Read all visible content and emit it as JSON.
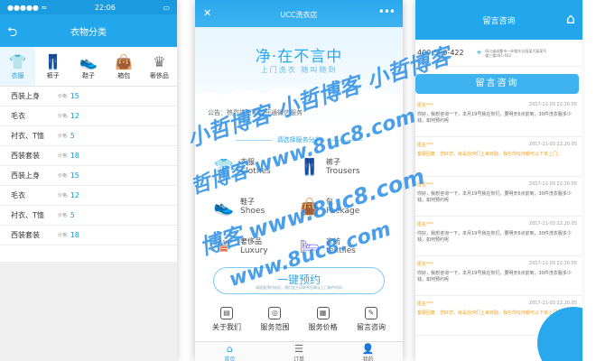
{
  "left": {
    "status": {
      "carrier": "●●●●● ≈",
      "time": "22:06",
      "battery": "▭"
    },
    "title": "衣物分类",
    "categories": [
      {
        "label": "衣服",
        "icon": "tshirt-icon",
        "glyph": "👕",
        "active": true
      },
      {
        "label": "裤子",
        "icon": "trousers-icon",
        "glyph": "👖",
        "active": false
      },
      {
        "label": "鞋子",
        "icon": "shoe-icon",
        "glyph": "👟",
        "active": false
      },
      {
        "label": "箱包",
        "icon": "bag-icon",
        "glyph": "👜",
        "active": false
      },
      {
        "label": "奢侈品",
        "icon": "crown-icon",
        "glyph": "♛",
        "active": false
      }
    ],
    "price_label": "价格:",
    "items": [
      {
        "name": "西装上身",
        "price": "15"
      },
      {
        "name": "毛衣",
        "price": "12"
      },
      {
        "name": "衬衣、T恤",
        "price": "5"
      },
      {
        "name": "西装套装",
        "price": "18"
      },
      {
        "name": "西装上身",
        "price": "15"
      },
      {
        "name": "毛衣",
        "price": "12"
      },
      {
        "name": "衬衣、T恤",
        "price": "5"
      },
      {
        "name": "西装套装",
        "price": "18"
      }
    ]
  },
  "center": {
    "title": "UCC洗衣店",
    "close_glyph": "✕",
    "more_glyph": "•••",
    "slogan": "净·在不言中",
    "slogan_sub": "上门洗衣  随叫随到",
    "notice": "公告：热烈祝贺本店开通微信服务",
    "section_title": "请选择服务分类",
    "services": [
      {
        "cn": "衣服",
        "en": "Clothes",
        "icon": "tshirt-icon",
        "glyph": "👕",
        "color": "#e84a8a"
      },
      {
        "cn": "裤子",
        "en": "Trousers",
        "icon": "trousers-icon",
        "glyph": "👖",
        "color": "#27b07a"
      },
      {
        "cn": "鞋子",
        "en": "Shoes",
        "icon": "shoe-icon",
        "glyph": "👟",
        "color": "#2ab7c8"
      },
      {
        "cn": "包",
        "en": "Package",
        "icon": "bag-icon",
        "glyph": "👜",
        "color": "#f2a21b"
      },
      {
        "cn": "奢侈品",
        "en": "Luxury",
        "icon": "crown-icon",
        "glyph": "♛",
        "color": "#e8663a"
      },
      {
        "cn": "家纺",
        "en": "textiles",
        "icon": "bed-icon",
        "glyph": "🛏",
        "color": "#7b6fe0"
      }
    ],
    "book_label": "一键预约",
    "book_note": "请留意预约电话，我们会主动联系您确认上门取件时间",
    "quick": [
      {
        "label": "关于我们",
        "icon": "about-icon",
        "glyph": "▤"
      },
      {
        "label": "服务范围",
        "icon": "scope-icon",
        "glyph": "◎"
      },
      {
        "label": "服务价格",
        "icon": "price-icon",
        "glyph": "▦"
      },
      {
        "label": "留言咨询",
        "icon": "message-icon",
        "glyph": "✎"
      }
    ],
    "tabs": [
      {
        "label": "首页",
        "icon": "home-icon",
        "glyph": "⌂",
        "active": true
      },
      {
        "label": "订单",
        "icon": "order-icon",
        "glyph": "☰",
        "active": false
      },
      {
        "label": "我的",
        "icon": "user-icon",
        "glyph": "👤",
        "active": false
      }
    ]
  },
  "right": {
    "title": "留言咨询",
    "home_glyph": "⌂",
    "phone": "400-500-422",
    "address": "四川省成都市一环路东五段某大厦某号楼三楼401-403",
    "msg_button": "留言咨询",
    "messages": [
      {
        "user": "匿名***",
        "time": "2017-11-03 22:20:05",
        "body": "你好，我想咨询一下，本月19号我在你们，要明天6点前到，30件洗衣服多少钱，如何预约呢",
        "reply": false
      },
      {
        "user": "匿名***",
        "time": "2017-11-03 22:20:05",
        "body": "客服回复：您好您，就是在你们上来收取，我在你在你都可以下单上门。",
        "reply": true
      },
      {
        "user": "匿名***",
        "time": "2017-11-03 22:20:05",
        "body": "你好，我想咨询一下，本月19号我在你们，要明天6点前到，30件洗衣服多少钱，如何预约呢",
        "reply": false
      },
      {
        "user": "匿名***",
        "time": "2017-11-03 22:20:05",
        "body": "你好，我想咨询一下，本月19号我在你们，要明天6点前到，30件洗衣服多少钱，如何预约呢",
        "reply": false
      },
      {
        "user": "匿名***",
        "time": "2017-11-03 22:20:05",
        "body": "你好，我想咨询一下，本月19号我在你们，要明天6点前到，30件洗衣服多少钱，如何预约呢",
        "reply": false
      },
      {
        "user": "匿名***",
        "time": "2017-11-03 22:20:05",
        "body": "客服回复：您好您，就是在你们上来收取，我在你在你都可以下单上门。",
        "reply": true
      }
    ]
  },
  "watermark": {
    "line1": "小哲博客 小哲博客 小哲博客",
    "line2": "哲博客 www.8uc8.com",
    "line3": "博客 www.8uc8.com",
    "line4": "www.8uc8.com"
  }
}
